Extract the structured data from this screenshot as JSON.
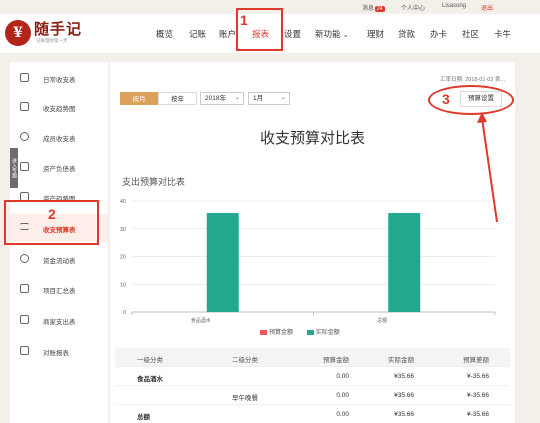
{
  "topbar": {
    "messages_label": "消息",
    "messages_count": "24",
    "personal_center": "个人中心",
    "username": "Lisasong",
    "logout": "退出"
  },
  "logo": {
    "mark": "¥",
    "name": "随手记",
    "slogan": "记账理财第一步"
  },
  "nav": {
    "items": [
      "概览",
      "记账",
      "账户",
      "报表",
      "设置",
      "新功能",
      "理财",
      "贷款",
      "办卡",
      "社区",
      "卡牛"
    ],
    "active": "报表",
    "new_feature_caret": "⌄"
  },
  "sidebar": {
    "tab_label": "进入专题",
    "items": [
      {
        "label": "日常收支表",
        "icon": "calendar-icon"
      },
      {
        "label": "收支趋势图",
        "icon": "trend-chart-icon"
      },
      {
        "label": "成员收支表",
        "icon": "member-icon"
      },
      {
        "label": "资产负债表",
        "icon": "balance-sheet-icon"
      },
      {
        "label": "资产趋势图",
        "icon": "asset-trend-icon"
      },
      {
        "label": "收支预算表",
        "icon": "sliders-icon"
      },
      {
        "label": "资金流动表",
        "icon": "cash-flow-icon"
      },
      {
        "label": "项目汇总表",
        "icon": "project-icon"
      },
      {
        "label": "商家支出表",
        "icon": "store-icon"
      },
      {
        "label": "对账报表",
        "icon": "reconcile-icon"
      }
    ],
    "active_index": 5
  },
  "toolbar": {
    "by_month": "按月",
    "by_year": "按年",
    "year_select": "2018年",
    "month_select": "1月",
    "date_prefix": "汇率日期: 2018-01-03",
    "date_suffix": "表...",
    "budget_settings": "预算设置"
  },
  "main": {
    "title": "收支预算对比表",
    "chart_title": "支出预算对比表"
  },
  "annotations": {
    "n1": "1",
    "n2": "2",
    "n3": "3"
  },
  "chart_data": {
    "type": "bar",
    "categories": [
      "食品酒水",
      "总额"
    ],
    "series": [
      {
        "name": "预算金额",
        "values": [
          0,
          0
        ],
        "color": "#e35b5b"
      },
      {
        "name": "实际金额",
        "values": [
          35.66,
          35.66
        ],
        "color": "#21a88f"
      }
    ],
    "ylim": [
      0,
      40
    ],
    "yticks": [
      0,
      10,
      20,
      30,
      40
    ],
    "grid": true,
    "legend": "bottom"
  },
  "table": {
    "headers": [
      "一级分类",
      "二级分类",
      "预算金额",
      "实际金额",
      "预算差额"
    ],
    "rows": [
      {
        "c1": "食品酒水",
        "c2": "",
        "c3": "0.00",
        "c4": "¥35.66",
        "c5": "¥-35.66",
        "bold": true
      },
      {
        "c1": "",
        "c2": "早午晚餐",
        "c3": "0.00",
        "c4": "¥35.66",
        "c5": "¥-35.66",
        "bold": false
      },
      {
        "c1": "总额",
        "c2": "",
        "c3": "0.00",
        "c4": "¥35.66",
        "c5": "¥-35.66",
        "bold": true
      }
    ]
  },
  "colors": {
    "accent": "#e0392b",
    "gold": "#d9a15a",
    "brand": "#b2261a"
  }
}
